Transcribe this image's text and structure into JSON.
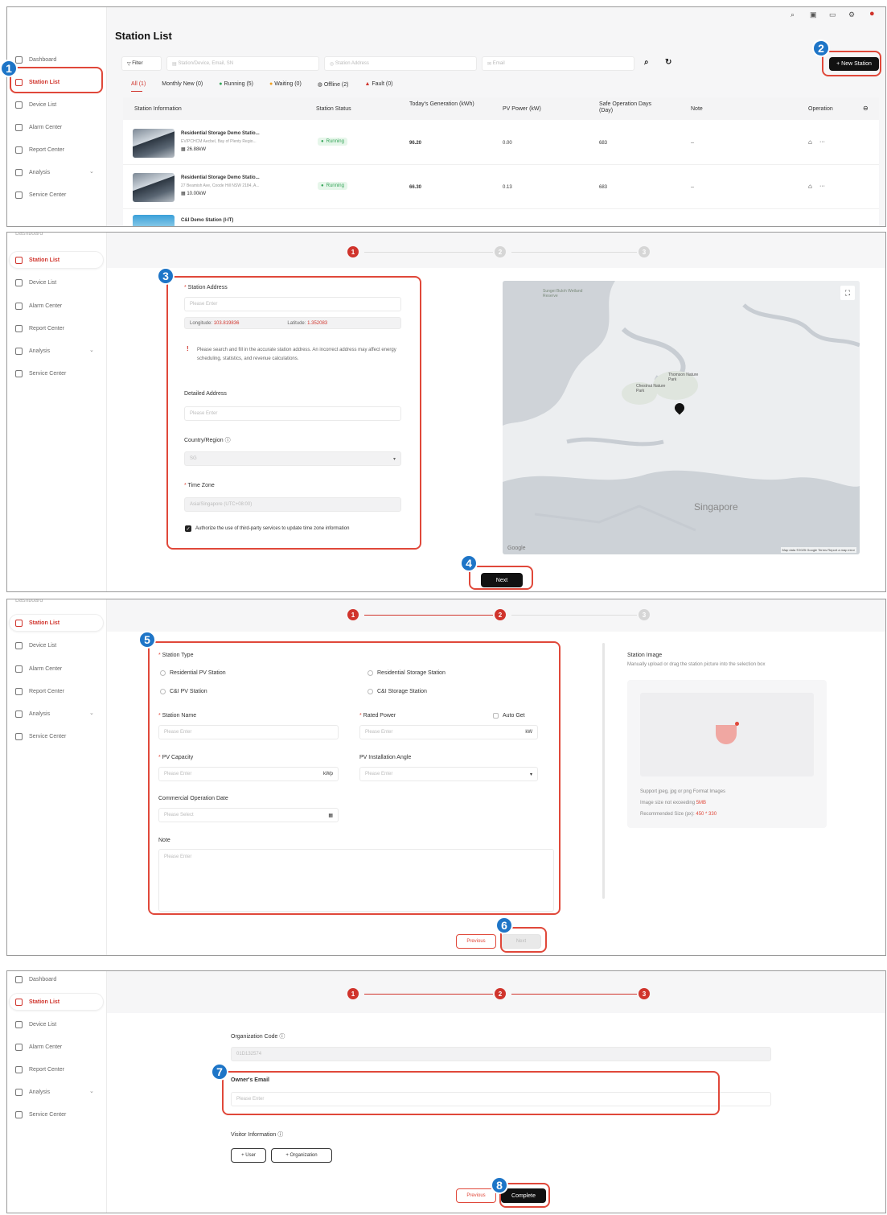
{
  "sidebar": {
    "items": [
      {
        "label": "Dashboard"
      },
      {
        "label": "Station List"
      },
      {
        "label": "Device List"
      },
      {
        "label": "Alarm Center"
      },
      {
        "label": "Report Center"
      },
      {
        "label": "Analysis"
      },
      {
        "label": "Service Center"
      }
    ],
    "truncated_top_label": "Dashboard"
  },
  "panel1": {
    "title": "Station List",
    "toolbar": {
      "filter_label": "Filter",
      "search_placeholder": "Station/Device, Email, SN",
      "address_placeholder": "Station Address",
      "email_placeholder": "Email",
      "new_station_label": "New Station"
    },
    "tabs": [
      {
        "label": "All (1)"
      },
      {
        "label": "Monthly New (0)"
      },
      {
        "label": "Running (5)"
      },
      {
        "label": "Waiting (0)"
      },
      {
        "label": "Offline (2)"
      },
      {
        "label": "Fault (0)"
      }
    ],
    "columns": [
      "Station Information",
      "Station Status",
      "Today's Generation (kWh)",
      "PV Power (kW)",
      "Safe Operation Days (Day)",
      "Note",
      "Operation"
    ],
    "rows": [
      {
        "name": "Residential Storage Demo Statio...",
        "address": "EV/PCHCM Aecbel, Bay of Plenty Regio...",
        "capacity": "26.88kW",
        "status": "Running",
        "generation": "96.20",
        "pv_power": "0.00",
        "days": "683",
        "note": "--",
        "more": "···"
      },
      {
        "name": "Residential Storage Demo Statio...",
        "address": "27 Beamish Ave, Coode Hill NSW 2184, A...",
        "capacity": "10.00kW",
        "status": "Running",
        "generation": "66.30",
        "pv_power": "0.13",
        "days": "683",
        "note": "--",
        "more": "···"
      },
      {
        "name": "C&I Demo Station (I-IT)"
      }
    ]
  },
  "panel2": {
    "steps": [
      "1",
      "2",
      "3"
    ],
    "station_address_label": "Station Address",
    "address_placeholder": "Please Enter",
    "longitude_label": "Longitude:",
    "longitude_value": "103.819836",
    "latitude_label": "Latitude:",
    "latitude_value": "1.352083",
    "warning": "Please search and fill in the accurate station address. An incorrect address may affect energy scheduling, statistics, and revenue calculations.",
    "detailed_address_label": "Detailed Address",
    "detailed_placeholder": "Please Enter",
    "country_label": "Country/Region",
    "country_value": "SG",
    "timezone_label": "Time Zone",
    "timezone_value": "Asia/Singapore (UTC+08:00)",
    "authorize_text": "Authorize the use of third-party services to update time zone information",
    "map_labels": {
      "park1": "Sungei Buloh Wetland Reserve",
      "park2": "Thomson Nature Park",
      "park3": "Chestnut Nature Park",
      "city": "Singapore",
      "google": "Google",
      "footer": "Map data ©2025 Google   Terms   Report a map error"
    },
    "next_label": "Next"
  },
  "panel3": {
    "station_type_label": "Station Type",
    "types": [
      "Residential PV Station",
      "Residential Storage Station",
      "C&I PV Station",
      "C&I Storage Station"
    ],
    "station_name_label": "Station Name",
    "rated_power_label": "Rated Power",
    "auto_get_label": "Auto Get",
    "kw_unit": "kW",
    "pv_capacity_label": "PV Capacity",
    "kwp_unit": "kWp",
    "pv_angle_label": "PV Installation Angle",
    "cod_label": "Commercial Operation Date",
    "cod_placeholder": "Please Select",
    "note_label": "Note",
    "placeholder": "Please Enter",
    "image_title": "Station Image",
    "image_desc": "Manually upload or drag the station picture into the selection box",
    "image_support": "Support jpeg, jpg or png Format Images",
    "image_size_text": "Image size not exceeding",
    "image_size_value": "5MB",
    "image_rec_text": "Recommended Size (px):",
    "image_rec_value": "450 * 330",
    "previous_label": "Previous",
    "next_label": "Next"
  },
  "panel4": {
    "org_code_label": "Organization Code",
    "org_code_value": "01D132574",
    "owner_email_label": "Owner's Email",
    "owner_email_placeholder": "Please Enter",
    "visitor_label": "Visitor Information",
    "user_btn": "+ User",
    "org_btn": "+ Organization",
    "previous_label": "Previous",
    "complete_label": "Complete"
  },
  "badges": [
    "1",
    "2",
    "3",
    "4",
    "5",
    "6",
    "7",
    "8"
  ],
  "colors": {
    "accent": "#d0342c",
    "callout": "#e0483a",
    "badge": "#1e75c7",
    "running": "#37a55a"
  }
}
